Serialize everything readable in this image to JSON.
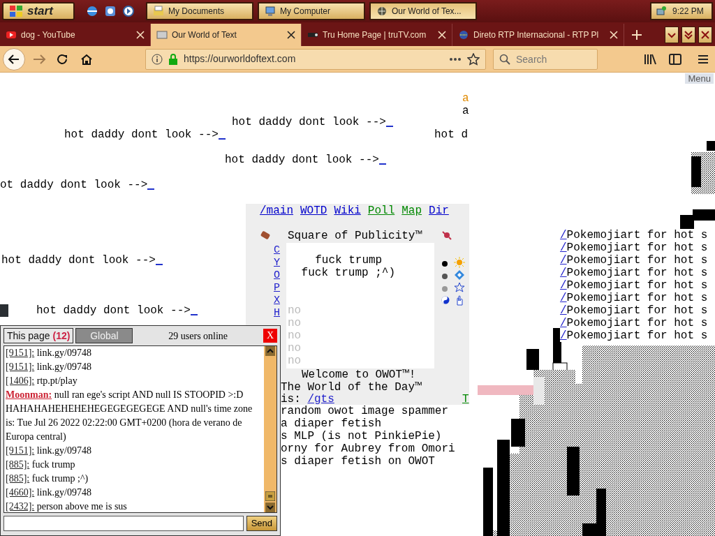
{
  "taskbar": {
    "start": "start",
    "tasks": [
      {
        "label": "My Documents",
        "selected": false
      },
      {
        "label": "My Computer",
        "selected": false
      },
      {
        "label": "Our World of Tex...",
        "selected": true
      }
    ],
    "clock": "9:22 PM"
  },
  "tabs": [
    {
      "label": "dog - YouTube",
      "selected": false
    },
    {
      "label": "Our World of Text",
      "selected": true
    },
    {
      "label": "Tru Home Page | truTV.com",
      "selected": false
    },
    {
      "label": "Direto RTP Internacional - RTP Pl",
      "selected": false
    }
  ],
  "address_bar": {
    "url": "https://ourworldoftext.com"
  },
  "search": {
    "placeholder": "Search"
  },
  "menu_label": "Menu",
  "canvas_texts": [
    {
      "text": "a",
      "color": "#e08a00",
      "link": false
    },
    {
      "text": "a",
      "color": "#000000",
      "link": false
    },
    {
      "text": "hot daddy dont look -->",
      "color": "#000000",
      "link": true
    },
    {
      "text": "hot daddy dont look -->",
      "color": "#000000",
      "link": true
    },
    {
      "text": "hot d",
      "color": "#000000",
      "link": false
    },
    {
      "text": "hot daddy dont look -->",
      "color": "#000000",
      "link": true
    },
    {
      "text": "ot daddy dont look -->",
      "color": "#000000",
      "link": true
    },
    {
      "text": "hot daddy dont look -->",
      "color": "#000000",
      "link": true
    },
    {
      "text": "hot daddy dont look -->",
      "color": "#000000",
      "link": true
    }
  ],
  "panel": {
    "links": [
      {
        "label": "/main",
        "color": "#0000cc"
      },
      {
        "label": "WOTD",
        "color": "#0000cc"
      },
      {
        "label": "Wiki",
        "color": "#0000cc"
      },
      {
        "label": "Poll",
        "color": "#008800"
      },
      {
        "label": "Map",
        "color": "#008800"
      },
      {
        "label": "Dir",
        "color": "#0000cc"
      }
    ],
    "title": "Square of Publicity™",
    "side_letters": [
      "C",
      "Y",
      "O",
      "P",
      "X",
      "H"
    ],
    "square_lines": [
      "  fuck trump",
      " fuck trump ;^)"
    ],
    "faded_lines": [
      "no",
      "no",
      "no",
      "no",
      "no"
    ],
    "dots": [
      {
        "color": "#000000"
      },
      {
        "color": "#555555"
      },
      {
        "color": "#999999"
      }
    ],
    "welcome": "Welcome to OWOT™!",
    "wotd_line": "The World of the Day™",
    "wotd_prefix": "is: ",
    "wotd_link": "/gts",
    "corner_link": "T"
  },
  "below_lines": [
    "random owot image spammer",
    "a diaper fetish",
    "s MLP (is not PinkiePie)",
    "orny for Aubrey from Omori",
    "s diaper fetish on OWOT"
  ],
  "right_lines": [
    {
      "slash": "/",
      "text": "Pokemojiart for hot s"
    },
    {
      "slash": "/",
      "text": "Pokemojiart for hot s"
    },
    {
      "slash": "/",
      "text": "Pokemojiart for hot s"
    },
    {
      "slash": "/",
      "text": "Pokemojiart for hot s"
    },
    {
      "slash": "/",
      "text": "Pokemojiart for hot s"
    },
    {
      "slash": "/",
      "text": "Pokemojiart for hot s"
    },
    {
      "slash": "/",
      "text": "Pokemojiart for hot s"
    },
    {
      "slash": "/",
      "text": "Pokemojiart for hot s"
    },
    {
      "slash": "/",
      "text": "Pokemojiart for hot s"
    }
  ],
  "chat": {
    "tabs": [
      {
        "label": "This page",
        "count": "(12)",
        "selected": true
      },
      {
        "label": "Global",
        "selected": false
      }
    ],
    "users_online": "29 users online",
    "close": "X",
    "messages": [
      {
        "kind": "anon",
        "author": "[9151]:",
        "text": "link.gy/09748"
      },
      {
        "kind": "anon",
        "author": "[9151]:",
        "text": "link.gy/09748"
      },
      {
        "kind": "anon",
        "author": "[1406]:",
        "text": "rtp.pt/play"
      },
      {
        "kind": "user",
        "author": "Moonman:",
        "text": "null ran ege's script AND null IS STOOPID >:D HAHAHAHEHEHEHEGEGEGEGEGE AND null's time zone is: Tue Jul 26 2022 02:22:00 GMT+0200 (hora de verano de Europa central)"
      },
      {
        "kind": "anon",
        "author": "[9151]:",
        "text": "link.gy/09748"
      },
      {
        "kind": "anon",
        "author": "[885]:",
        "text": "fuck trump"
      },
      {
        "kind": "anon",
        "author": "[885]:",
        "text": "fuck trump ;^)"
      },
      {
        "kind": "anon",
        "author": "[4660]:",
        "text": "link.gy/09748"
      },
      {
        "kind": "anon",
        "author": "[2432]:",
        "text": "person above me is sus"
      }
    ],
    "send": "Send"
  }
}
